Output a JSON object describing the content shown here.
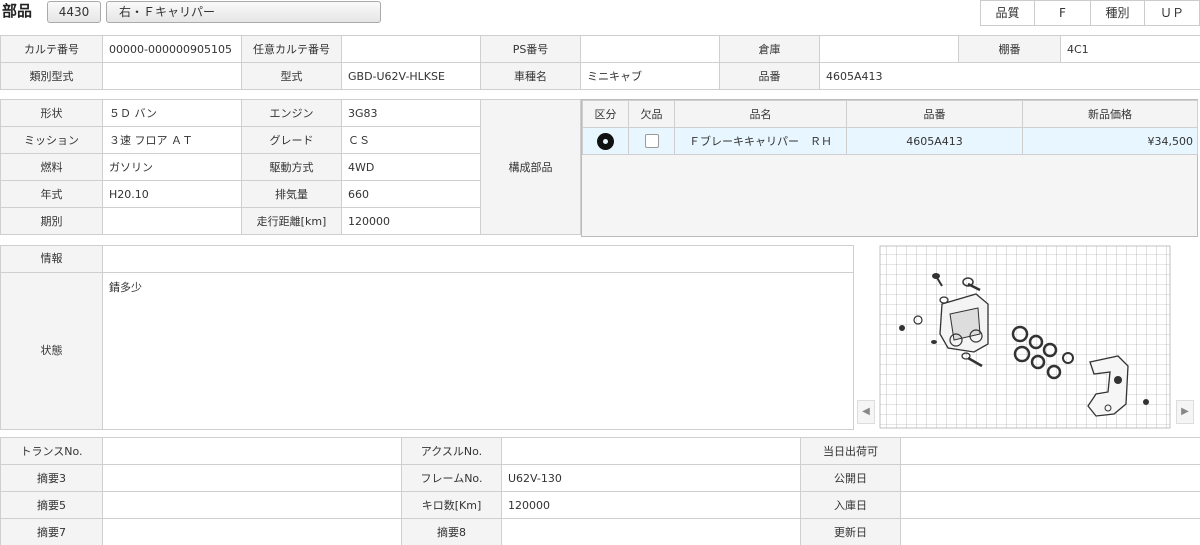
{
  "header": {
    "title": "部品",
    "code": "4430",
    "part_name": "右・Ｆキャリパー",
    "quality_label": "品質",
    "quality_value": "F",
    "type_label": "種別",
    "type_value": "ＵＰ"
  },
  "row1": {
    "karte_label": "カルテ番号",
    "karte_value": "00000-000000905105",
    "opt_karte_label": "任意カルテ番号",
    "opt_karte_value": "",
    "ps_label": "PS番号",
    "ps_value": "",
    "warehouse_label": "倉庫",
    "warehouse_value": "",
    "shelf_label": "棚番",
    "shelf_value": "4C1"
  },
  "row2": {
    "class_label": "類別型式",
    "class_value": "",
    "model_label": "型式",
    "model_value": "GBD-U62V-HLKSE",
    "car_label": "車種名",
    "car_value": "ミニキャブ",
    "partno_label": "品番",
    "partno_value": "4605A413"
  },
  "vehicle": {
    "shape_label": "形状",
    "shape_value": "５Ｄ バン",
    "engine_label": "エンジン",
    "engine_value": "3G83",
    "mission_label": "ミッション",
    "mission_value": "３速 フロア ＡＴ",
    "grade_label": "グレード",
    "grade_value": "ＣＳ",
    "fuel_label": "燃料",
    "fuel_value": "ガソリン",
    "drive_label": "駆動方式",
    "drive_value": "4WD",
    "year_label": "年式",
    "year_value": "H20.10",
    "disp_label": "排気量",
    "disp_value": "660",
    "period_label": "期別",
    "period_value": "",
    "mileage_label": "走行距離[km]",
    "mileage_value": "120000",
    "components_label": "構成部品"
  },
  "parts": {
    "headers": {
      "kubun": "区分",
      "missing": "欠品",
      "name": "品名",
      "number": "品番",
      "price": "新品価格"
    },
    "rows": [
      {
        "icon": "disc-icon",
        "missing": false,
        "name": "Ｆブレーキキャリパー　ＲＨ",
        "number": "4605A413",
        "price": "¥34,500"
      }
    ]
  },
  "info": {
    "info_label": "情報",
    "info_value": "",
    "state_label": "状態",
    "state_value": "錆多少"
  },
  "bottom": {
    "trans_label": "トランスNo.",
    "trans_value": "",
    "axle_label": "アクスルNo.",
    "axle_value": "",
    "ship_label": "当日出荷可",
    "ship_value": "",
    "memo3_label": "摘要3",
    "memo3_value": "",
    "frame_label": "フレームNo.",
    "frame_value": "U62V-130",
    "publish_label": "公開日",
    "publish_value": "",
    "memo5_label": "摘要5",
    "memo5_value": "",
    "km_label": "キロ数[Km]",
    "km_value": "120000",
    "stock_label": "入庫日",
    "stock_value": "",
    "memo7_label": "摘要7",
    "memo7_value": "",
    "memo8_label": "摘要8",
    "memo8_value": "",
    "update_label": "更新日",
    "update_value": ""
  },
  "viewer": {
    "prev": "◀",
    "next": "▶"
  }
}
